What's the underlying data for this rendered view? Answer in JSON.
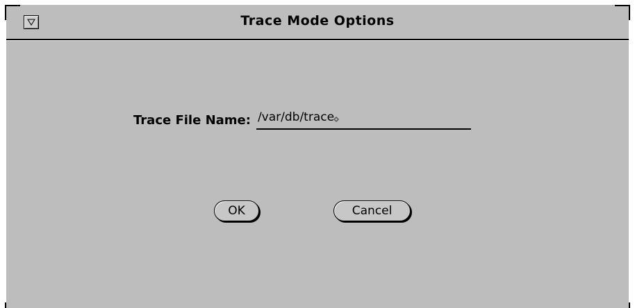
{
  "window": {
    "title": "Trace Mode Options",
    "menu_icon": "triangle-down-icon"
  },
  "form": {
    "trace_file": {
      "label": "Trace File Name:",
      "value": "/var/db/trace"
    }
  },
  "buttons": {
    "ok_label": "OK",
    "cancel_label": "Cancel"
  },
  "colors": {
    "background": "#bdbdbd",
    "border": "#ffffff",
    "text": "#000000"
  }
}
